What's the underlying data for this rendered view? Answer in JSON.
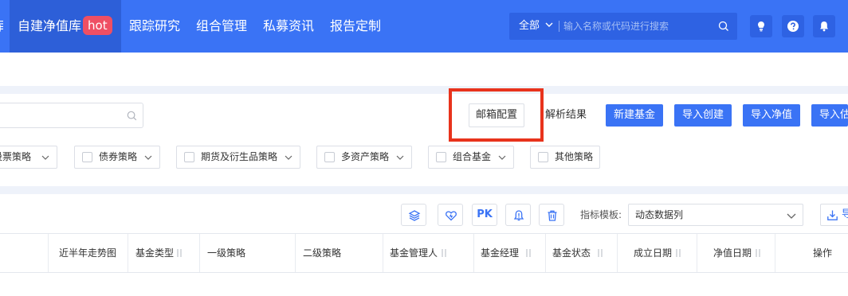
{
  "nav": {
    "items": [
      {
        "label": "自建净值库",
        "badge": "hot",
        "active": true
      },
      {
        "label": "跟踪研究"
      },
      {
        "label": "组合管理"
      },
      {
        "label": "私募资讯"
      },
      {
        "label": "报告定制"
      }
    ],
    "search": {
      "scope": "全部",
      "placeholder": "输入名称或代码进行搜索"
    },
    "icons": [
      "lightbulb-icon",
      "help-icon",
      "bell-icon"
    ]
  },
  "toolbar": {
    "email_config": "邮箱配置",
    "parse_result": "解析结果",
    "new_fund": "新建基金",
    "import_create": "导入创建",
    "import_nav": "导入净值",
    "import_valuation": "导入估"
  },
  "strategies": [
    {
      "label": "股票策略",
      "dropdown": true
    },
    {
      "label": "债券策略",
      "dropdown": true
    },
    {
      "label": "期货及衍生品策略",
      "dropdown": true
    },
    {
      "label": "多资产策略",
      "dropdown": true
    },
    {
      "label": "组合基金",
      "dropdown": true
    },
    {
      "label": "其他策略",
      "dropdown": false
    }
  ],
  "tools": {
    "pk_label": "PK",
    "template_label": "指标模板:",
    "template_value": "动态数据列",
    "export_label": "导"
  },
  "table": {
    "columns": [
      {
        "label": "近半年走势图",
        "sortable": false
      },
      {
        "label": "基金类型",
        "sortable": true
      },
      {
        "label": "一级策略",
        "sortable": false
      },
      {
        "label": "二级策略",
        "sortable": false
      },
      {
        "label": "基金管理人",
        "sortable": true
      },
      {
        "label": "基金经理",
        "sortable": true
      },
      {
        "label": "基金状态",
        "sortable": true
      },
      {
        "label": "成立日期",
        "sortable": true
      },
      {
        "label": "净值日期",
        "sortable": true
      },
      {
        "label": "操作",
        "sortable": false
      }
    ]
  },
  "colors": {
    "primary": "#3a73f5",
    "nav_active": "#2d5fd8",
    "hot": "#ef4f63",
    "highlight": "#e8331c"
  }
}
